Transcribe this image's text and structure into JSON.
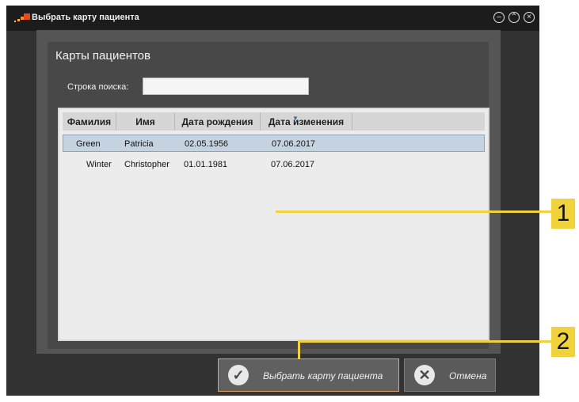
{
  "window": {
    "title": "Выбрать карту пациента",
    "controls": [
      "minimize-icon",
      "maximize-icon",
      "close-icon"
    ]
  },
  "panel": {
    "title": "Карты пациентов",
    "search_label": "Строка поиска:",
    "search_value": "",
    "search_placeholder": ""
  },
  "table": {
    "columns": [
      "Фамилия",
      "Имя",
      "Дата рождения",
      "Дата изменения"
    ],
    "sorted_column": "Дата изменения",
    "rows": [
      {
        "last_name": "Green",
        "first_name": "Patricia",
        "birth_date": "02.05.1956",
        "modified": "07.06.2017",
        "selected": true
      },
      {
        "last_name": "Winter",
        "first_name": "Christopher",
        "birth_date": "01.01.1981",
        "modified": "07.06.2017",
        "selected": false
      }
    ]
  },
  "buttons": {
    "select_label": "Выбрать карту пациента",
    "cancel_label": "Отмена"
  },
  "callouts": [
    "1",
    "2"
  ],
  "colors": {
    "callout": "#f2d23a",
    "accent_border": "#e2a06a",
    "selection": "#c5d3e0"
  }
}
